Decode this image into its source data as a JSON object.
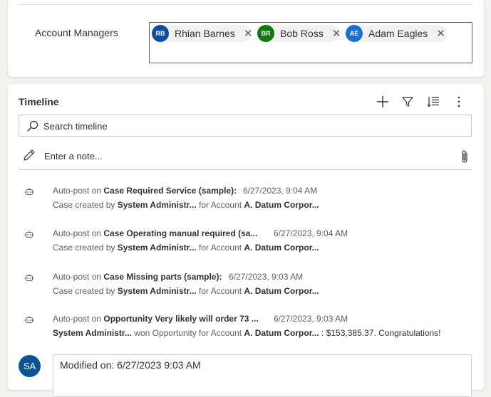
{
  "account_managers": {
    "label": "Account Managers",
    "chips": [
      {
        "initials": "RB",
        "name": "Rhian Barnes",
        "color": "#0b4f9e"
      },
      {
        "initials": "BR",
        "name": "Bob Ross",
        "color": "#0e7a0d"
      },
      {
        "initials": "AE",
        "name": "Adam Eagles",
        "color": "#1a6fd1"
      }
    ],
    "remove_glyph": "✕"
  },
  "timeline": {
    "title": "Timeline",
    "tools": [
      "add-icon",
      "filter-icon",
      "sort-list-icon",
      "more-icon"
    ],
    "search_placeholder": "Search timeline",
    "note_placeholder": "Enter a note...",
    "posts": [
      {
        "prefix": "Auto-post on ",
        "subject": "Case Required Service (sample):",
        "time": "6/27/2023, 9:04 AM",
        "l2a": "Case created by ",
        "l2b": "System Administr...",
        "l2c": " for Account ",
        "l2d": "A. Datum Corpor...",
        "l2e": ""
      },
      {
        "prefix": "Auto-post on ",
        "subject": "Case Operating manual required (sa...",
        "time": "6/27/2023, 9:04 AM",
        "l2a": "Case created by ",
        "l2b": "System Administr...",
        "l2c": " for Account ",
        "l2d": "A. Datum Corpor...",
        "l2e": ""
      },
      {
        "prefix": "Auto-post on ",
        "subject": "Case Missing parts (sample):",
        "time": "6/27/2023, 9:03 AM",
        "l2a": "Case created by ",
        "l2b": "System Administr...",
        "l2c": " for Account ",
        "l2d": "A. Datum Corpor...",
        "l2e": ""
      },
      {
        "prefix": "Auto-post on ",
        "subject": "Opportunity Very likely will order 73 ...",
        "time": "6/27/2023, 9:03 AM",
        "l2a": "",
        "l2b": "System Administr...",
        "l2c": " won Opportunity for Account ",
        "l2d": "A. Datum Corpor...",
        "l2e": " : $153,385.37. Congratulations!"
      }
    ],
    "modified": {
      "avatar_initials": "SA",
      "text": "Modified on: 6/27/2023 9:03 AM"
    }
  }
}
